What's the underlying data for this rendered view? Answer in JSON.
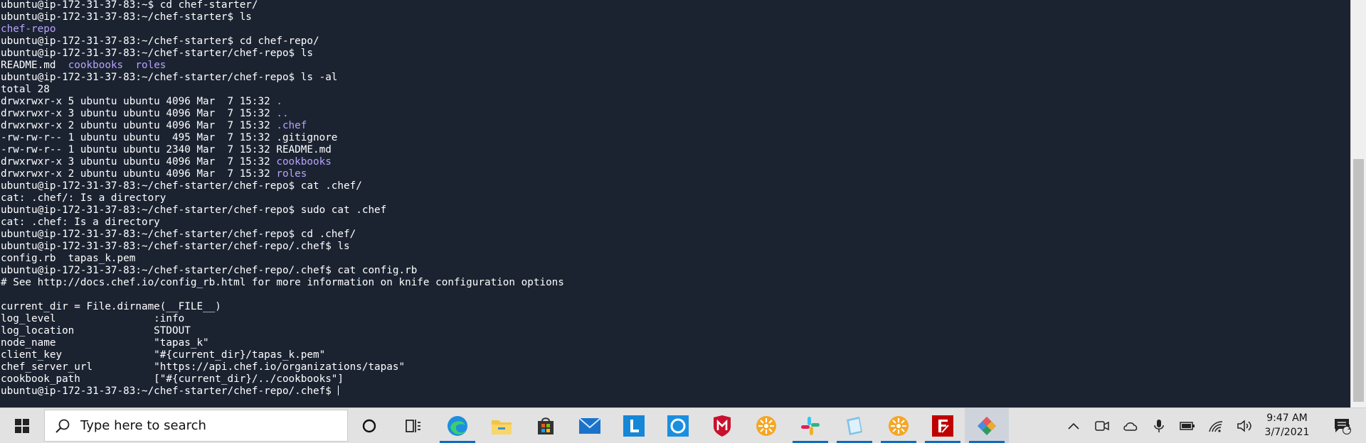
{
  "terminal": {
    "lines": [
      {
        "segments": [
          {
            "text": "ubuntu@ip-172-31-37-83:~$ cd chef-starter/"
          }
        ]
      },
      {
        "segments": [
          {
            "text": "ubuntu@ip-172-31-37-83:~/chef-starter$ ls"
          }
        ]
      },
      {
        "segments": [
          {
            "text": "chef-repo",
            "dir": true
          }
        ]
      },
      {
        "segments": [
          {
            "text": "ubuntu@ip-172-31-37-83:~/chef-starter$ cd chef-repo/"
          }
        ]
      },
      {
        "segments": [
          {
            "text": "ubuntu@ip-172-31-37-83:~/chef-starter/chef-repo$ ls"
          }
        ]
      },
      {
        "segments": [
          {
            "text": "README.md  "
          },
          {
            "text": "cookbooks",
            "dir": true
          },
          {
            "text": "  "
          },
          {
            "text": "roles",
            "dir": true
          }
        ]
      },
      {
        "segments": [
          {
            "text": "ubuntu@ip-172-31-37-83:~/chef-starter/chef-repo$ ls -al"
          }
        ]
      },
      {
        "segments": [
          {
            "text": "total 28"
          }
        ]
      },
      {
        "segments": [
          {
            "text": "drwxrwxr-x 5 ubuntu ubuntu 4096 Mar  7 15:32 "
          },
          {
            "text": ".",
            "dir": true
          }
        ]
      },
      {
        "segments": [
          {
            "text": "drwxrwxr-x 3 ubuntu ubuntu 4096 Mar  7 15:32 "
          },
          {
            "text": "..",
            "dir": true
          }
        ]
      },
      {
        "segments": [
          {
            "text": "drwxrwxr-x 2 ubuntu ubuntu 4096 Mar  7 15:32 "
          },
          {
            "text": ".chef",
            "dir": true
          }
        ]
      },
      {
        "segments": [
          {
            "text": "-rw-rw-r-- 1 ubuntu ubuntu  495 Mar  7 15:32 .gitignore"
          }
        ]
      },
      {
        "segments": [
          {
            "text": "-rw-rw-r-- 1 ubuntu ubuntu 2340 Mar  7 15:32 README.md"
          }
        ]
      },
      {
        "segments": [
          {
            "text": "drwxrwxr-x 3 ubuntu ubuntu 4096 Mar  7 15:32 "
          },
          {
            "text": "cookbooks",
            "dir": true
          }
        ]
      },
      {
        "segments": [
          {
            "text": "drwxrwxr-x 2 ubuntu ubuntu 4096 Mar  7 15:32 "
          },
          {
            "text": "roles",
            "dir": true
          }
        ]
      },
      {
        "segments": [
          {
            "text": "ubuntu@ip-172-31-37-83:~/chef-starter/chef-repo$ cat .chef/"
          }
        ]
      },
      {
        "segments": [
          {
            "text": "cat: .chef/: Is a directory"
          }
        ]
      },
      {
        "segments": [
          {
            "text": "ubuntu@ip-172-31-37-83:~/chef-starter/chef-repo$ sudo cat .chef"
          }
        ]
      },
      {
        "segments": [
          {
            "text": "cat: .chef: Is a directory"
          }
        ]
      },
      {
        "segments": [
          {
            "text": "ubuntu@ip-172-31-37-83:~/chef-starter/chef-repo$ cd .chef/"
          }
        ]
      },
      {
        "segments": [
          {
            "text": "ubuntu@ip-172-31-37-83:~/chef-starter/chef-repo/.chef$ ls"
          }
        ]
      },
      {
        "segments": [
          {
            "text": "config.rb  tapas_k.pem"
          }
        ]
      },
      {
        "segments": [
          {
            "text": "ubuntu@ip-172-31-37-83:~/chef-starter/chef-repo/.chef$ cat config.rb"
          }
        ]
      },
      {
        "segments": [
          {
            "text": "# See http://docs.chef.io/config_rb.html for more information on knife configuration options"
          }
        ]
      },
      {
        "segments": [
          {
            "text": ""
          }
        ]
      },
      {
        "segments": [
          {
            "text": "current_dir = File.dirname(__FILE__)"
          }
        ]
      },
      {
        "segments": [
          {
            "text": "log_level                :info"
          }
        ]
      },
      {
        "segments": [
          {
            "text": "log_location             STDOUT"
          }
        ]
      },
      {
        "segments": [
          {
            "text": "node_name                \"tapas_k\""
          }
        ]
      },
      {
        "segments": [
          {
            "text": "client_key               \"#{current_dir}/tapas_k.pem\""
          }
        ]
      },
      {
        "segments": [
          {
            "text": "chef_server_url          \"https://api.chef.io/organizations/tapas\""
          }
        ]
      },
      {
        "segments": [
          {
            "text": "cookbook_path            [\"#{current_dir}/../cookbooks\"]"
          }
        ]
      },
      {
        "segments": [
          {
            "text": "ubuntu@ip-172-31-37-83:~/chef-starter/chef-repo/.chef$ "
          }
        ],
        "cursor": true
      }
    ]
  },
  "taskbar": {
    "search_placeholder": "Type here to search",
    "clock_time": "9:47 AM",
    "clock_date": "3/7/2021",
    "notification_count": "1",
    "colors": {
      "accent": "#0f6cbd",
      "terminal_bg": "#1b2331",
      "dir": "#b8a2ff"
    }
  }
}
